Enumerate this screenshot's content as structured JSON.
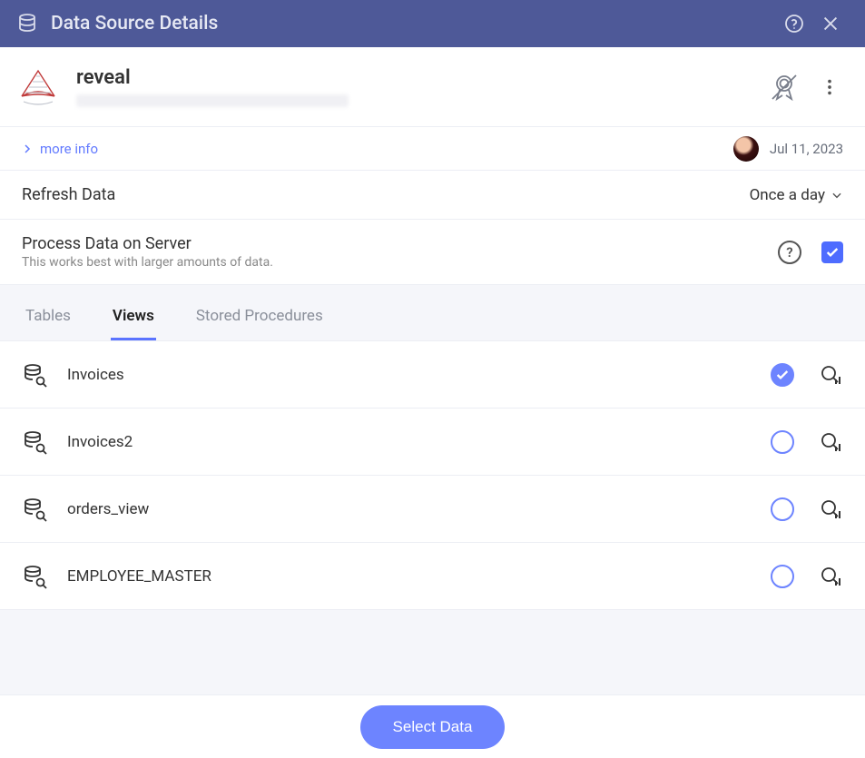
{
  "titlebar": {
    "title": "Data Source Details"
  },
  "datasource": {
    "name": "reveal",
    "more_info_label": "more info",
    "date": "Jul 11, 2023"
  },
  "settings": {
    "refresh": {
      "label": "Refresh Data",
      "value": "Once a day"
    },
    "process_on_server": {
      "label": "Process Data on Server",
      "sublabel": "This works best with larger amounts of data.",
      "checked": true
    }
  },
  "tabs": {
    "active_index": 1,
    "items": [
      "Tables",
      "Views",
      "Stored Procedures"
    ]
  },
  "views": [
    {
      "name": "Invoices",
      "selected": true
    },
    {
      "name": "Invoices2",
      "selected": false
    },
    {
      "name": "orders_view",
      "selected": false
    },
    {
      "name": "EMPLOYEE_MASTER",
      "selected": false
    }
  ],
  "footer": {
    "select_label": "Select Data"
  }
}
